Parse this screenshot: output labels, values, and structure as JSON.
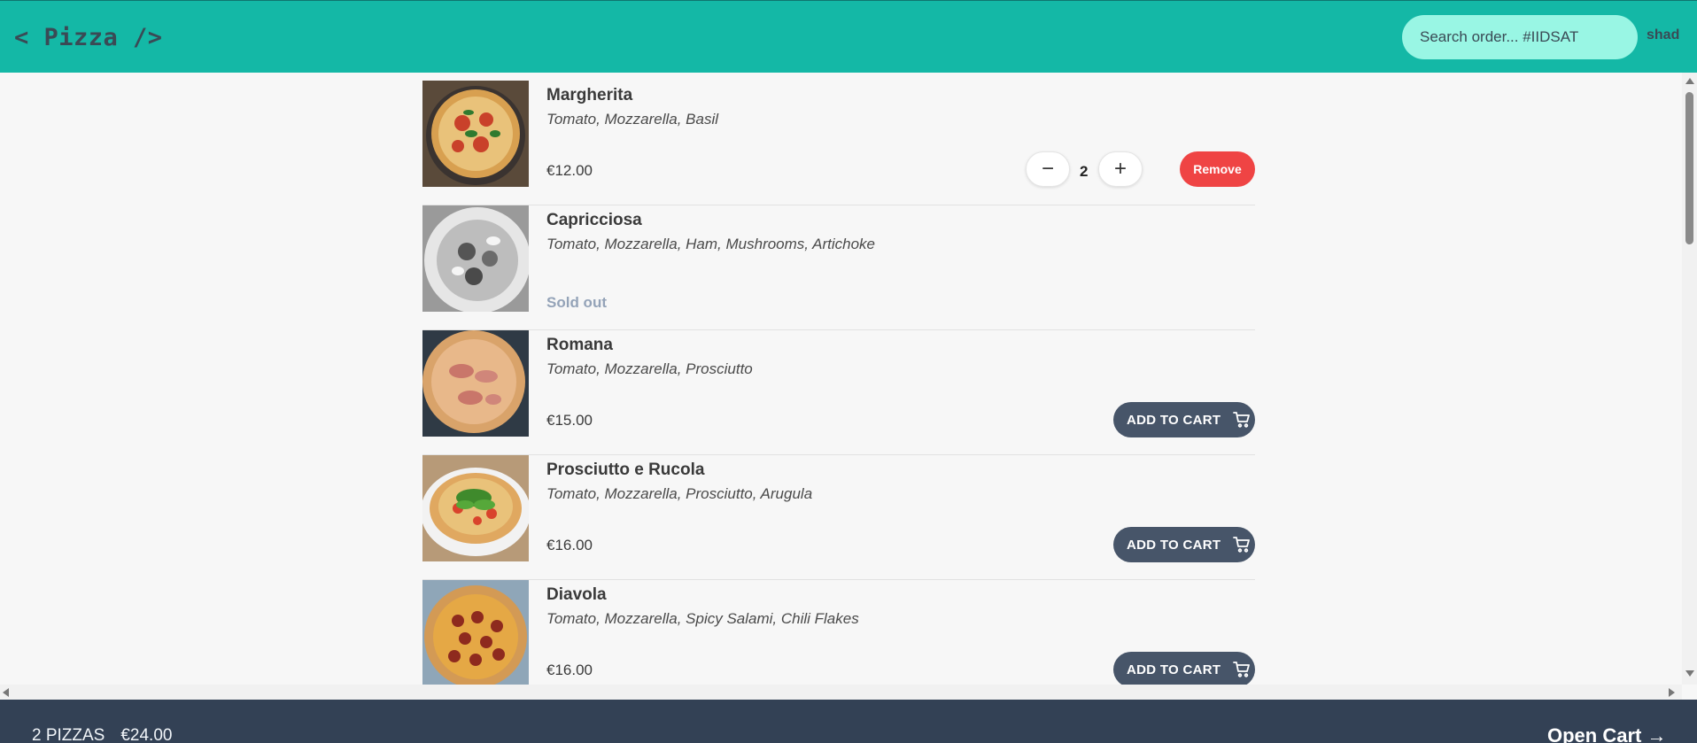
{
  "header": {
    "logo": "< Pizza />",
    "search_placeholder": "Search order... #IIDSAT",
    "username": "shad"
  },
  "menu": [
    {
      "name": "Margherita",
      "ingredients": "Tomato, Mozzarella, Basil",
      "price": "€12.00",
      "in_cart": true,
      "quantity": "2",
      "remove_label": "Remove"
    },
    {
      "name": "Capricciosa",
      "ingredients": "Tomato, Mozzarella, Ham, Mushrooms, Artichoke",
      "sold_out": "Sold out"
    },
    {
      "name": "Romana",
      "ingredients": "Tomato, Mozzarella, Prosciutto",
      "price": "€15.00",
      "add_label": "ADD TO CART"
    },
    {
      "name": "Prosciutto e Rucola",
      "ingredients": "Tomato, Mozzarella, Prosciutto, Arugula",
      "price": "€16.00",
      "add_label": "ADD TO CART"
    },
    {
      "name": "Diavola",
      "ingredients": "Tomato, Mozzarella, Spicy Salami, Chili Flakes",
      "price": "€16.00",
      "add_label": "ADD TO CART"
    }
  ],
  "footer": {
    "pizza_count": "2 PIZZAS",
    "total": "€24.00",
    "open_cart": "Open Cart →"
  },
  "colors": {
    "header": "#14b8a6",
    "search": "#99f6e4",
    "remove": "#ef4444",
    "add_button": "#475569",
    "footer": "#334155"
  }
}
